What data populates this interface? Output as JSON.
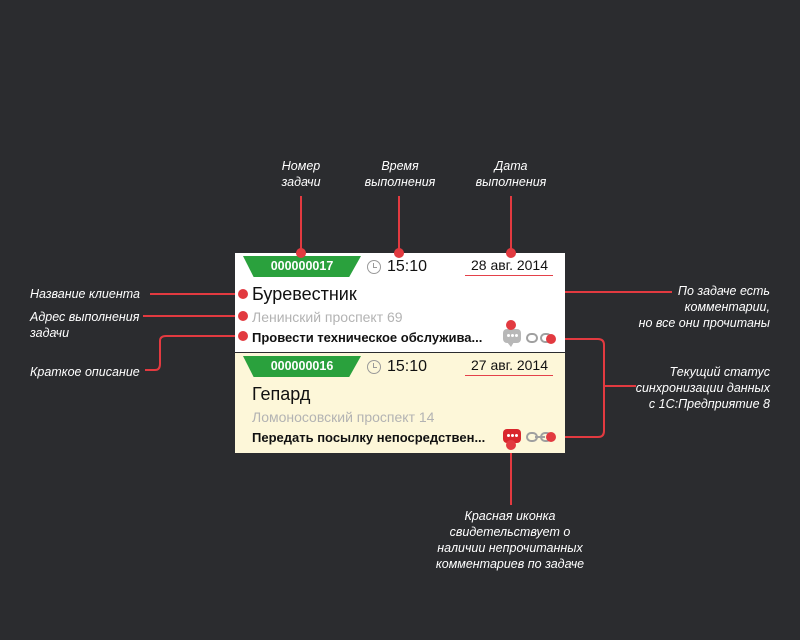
{
  "annotations": {
    "task_number": "Номер\nзадачи",
    "exec_time": "Время\nвыполнения",
    "exec_date": "Дата\nвыполнения",
    "client_name": "Название клиента",
    "exec_address": "Адрес выполнения\nзадачи",
    "short_desc": "Краткое описание",
    "comments_read": "По задаче есть\nкомментарии,\nно все они прочитаны",
    "sync_status": "Текущий статус\nсинхронизации данных\nс 1С:Предприятие 8",
    "unread_icon": "Красная иконка\nсвидетельствует о\nналичии непрочитанных\nкомментариев по задаче"
  },
  "tasks": [
    {
      "number": "000000017",
      "time": "15:10",
      "date": "28 авг. 2014",
      "client": "Буревестник",
      "address": "Ленинский проспект 69",
      "description": "Провести техническое обслужива...",
      "comment_icon": "speech-bubble-icon",
      "comment_state": "read",
      "sync_icon": "broken-link-icon"
    },
    {
      "number": "000000016",
      "time": "15:10",
      "date": "27 авг. 2014",
      "client": "Гепард",
      "address": "Ломоносовский проспект 14",
      "description": "Передать посылку непосредствен...",
      "comment_icon": "speech-bubble-icon",
      "comment_state": "unread",
      "sync_icon": "link-icon"
    }
  ],
  "colors": {
    "background": "#2b2c2f",
    "badge_green": "#2aa13d",
    "callout_red": "#e23a40",
    "selected_row": "#fdf7d9",
    "read_comment": "#b8b8b8",
    "unread_comment": "#d9262c"
  }
}
